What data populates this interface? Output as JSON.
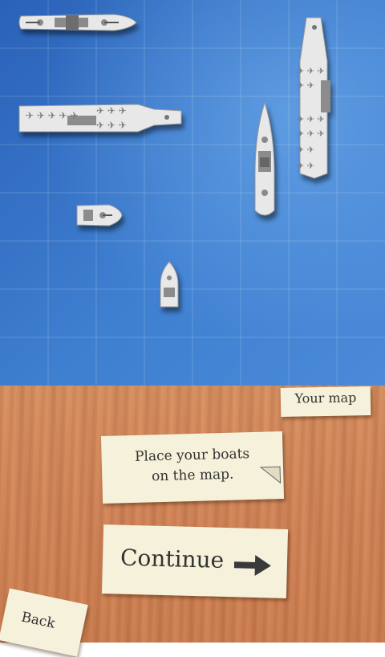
{
  "panel": {
    "label": "Your map"
  },
  "instruction": {
    "line1": "Place your boats",
    "line2": "on the map."
  },
  "actions": {
    "continue_label": "Continue",
    "back_label": "Back"
  },
  "colors": {
    "sea": "#3a78cc",
    "wood": "#d4875a",
    "paper": "#f5f1da",
    "ship": "#e6e6e6"
  },
  "icons": {
    "continue": "arrow-right-icon"
  },
  "boats": [
    "battleship",
    "aircraft-carrier",
    "aircraft-carrier",
    "cruiser",
    "destroyer",
    "patrol-boat"
  ]
}
